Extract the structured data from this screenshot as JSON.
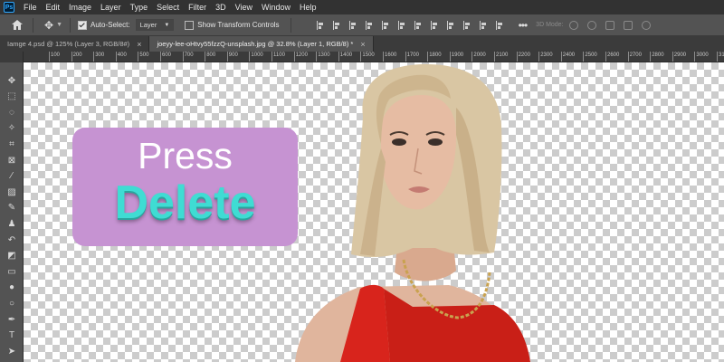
{
  "app": {
    "logo": "Ps"
  },
  "menu": [
    "File",
    "Edit",
    "Image",
    "Layer",
    "Type",
    "Select",
    "Filter",
    "3D",
    "View",
    "Window",
    "Help"
  ],
  "options": {
    "auto_select_label": "Auto-Select:",
    "auto_select_checked": true,
    "layer_select_value": "Layer",
    "show_transform_label": "Show Transform Controls",
    "show_transform_checked": false,
    "more_label": "•••",
    "mode_3d_label": "3D Mode:"
  },
  "tabs": [
    {
      "title": "Iamge 4.psd @ 125% (Layer 3, RGB/8#)",
      "close": "×",
      "active": false
    },
    {
      "title": "joeyy-lee-oHtvy55fzzQ-unsplash.jpg @ 32.8% (Layer 1, RGB/8) *",
      "close": "×",
      "active": true
    }
  ],
  "ruler": {
    "labels": [
      "100",
      "200",
      "300",
      "400",
      "500",
      "600",
      "700",
      "800",
      "900",
      "1000",
      "1100",
      "1200",
      "1300",
      "1400",
      "1500",
      "1600",
      "1700",
      "1800",
      "1900",
      "2000",
      "2100",
      "2200",
      "2300",
      "2400",
      "2500",
      "2600",
      "2700",
      "2800",
      "2900",
      "3000",
      "3100",
      "3200"
    ]
  },
  "tools": [
    {
      "name": "move-tool-icon",
      "glyph": "✥"
    },
    {
      "name": "marquee-tool-icon",
      "glyph": "⬚"
    },
    {
      "name": "lasso-tool-icon",
      "glyph": "◌"
    },
    {
      "name": "magic-wand-tool-icon",
      "glyph": "✧"
    },
    {
      "name": "crop-tool-icon",
      "glyph": "⌗"
    },
    {
      "name": "frame-tool-icon",
      "glyph": "⊠"
    },
    {
      "name": "eyedropper-tool-icon",
      "glyph": "⁄"
    },
    {
      "name": "healing-brush-tool-icon",
      "glyph": "▨"
    },
    {
      "name": "brush-tool-icon",
      "glyph": "✎"
    },
    {
      "name": "clone-stamp-tool-icon",
      "glyph": "♟"
    },
    {
      "name": "history-brush-tool-icon",
      "glyph": "↶"
    },
    {
      "name": "eraser-tool-icon",
      "glyph": "◩"
    },
    {
      "name": "gradient-tool-icon",
      "glyph": "▭"
    },
    {
      "name": "blur-tool-icon",
      "glyph": "●"
    },
    {
      "name": "dodge-tool-icon",
      "glyph": "○"
    },
    {
      "name": "pen-tool-icon",
      "glyph": "✒"
    },
    {
      "name": "type-tool-icon",
      "glyph": "T"
    },
    {
      "name": "path-selection-tool-icon",
      "glyph": "➤"
    }
  ],
  "overlay": {
    "line1": "Press",
    "line2": "Delete",
    "background_color": "#c693d2",
    "line2_color": "#3fdcd3"
  },
  "colors": {
    "accent_ps": "#31a8ff",
    "ui_dark": "#323232",
    "ui_mid": "#535353",
    "dress_red": "#d8241c",
    "hair_blonde": "#d9c6a3"
  }
}
